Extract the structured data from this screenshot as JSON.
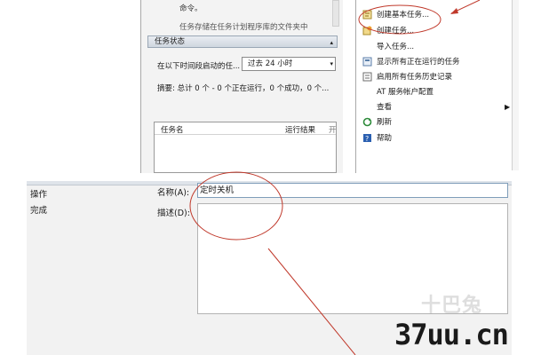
{
  "top_panel": {
    "desc_line1": "命令。",
    "desc_line2": "任务存储在任务计划程序库的文件夹中",
    "status_section": {
      "title": "任务状态",
      "arrow": "▴"
    },
    "time_filter": {
      "label": "在以下时间段启动的任...",
      "selected": "过去 24 小时",
      "chevron": "▾"
    },
    "summary": "摘要: 总计 0 个 - 0 个正在运行，0 个成功，0 个...",
    "task_table": {
      "columns": [
        "任务名",
        "运行结果",
        "开"
      ]
    },
    "actions": [
      {
        "label": "创建基本任务...",
        "icon": "create-basic-task-icon"
      },
      {
        "label": "创建任务...",
        "icon": "create-task-icon"
      },
      {
        "label": "导入任务...",
        "icon": "import-task-icon"
      },
      {
        "label": "显示所有正在运行的任务",
        "icon": "running-tasks-icon"
      },
      {
        "label": "启用所有任务历史记录",
        "icon": "history-icon"
      },
      {
        "label": "AT 服务帐户配置",
        "icon": "at-config-icon"
      },
      {
        "label": "查看",
        "icon": "view-icon",
        "submenu_arrow": "▶"
      },
      {
        "label": "刷新",
        "icon": "refresh-icon"
      },
      {
        "label": "帮助",
        "icon": "help-icon"
      }
    ]
  },
  "bottom_panel": {
    "nav": [
      "操作",
      "完成"
    ],
    "name_label": "名称(A):",
    "name_value": "定时关机",
    "desc_label": "描述(D):"
  },
  "watermark": {
    "logo": "十巴兔",
    "site": "37uu.cn"
  },
  "colors": {
    "annotation_red": "#c0392b",
    "input_border": "#7f9db9"
  }
}
